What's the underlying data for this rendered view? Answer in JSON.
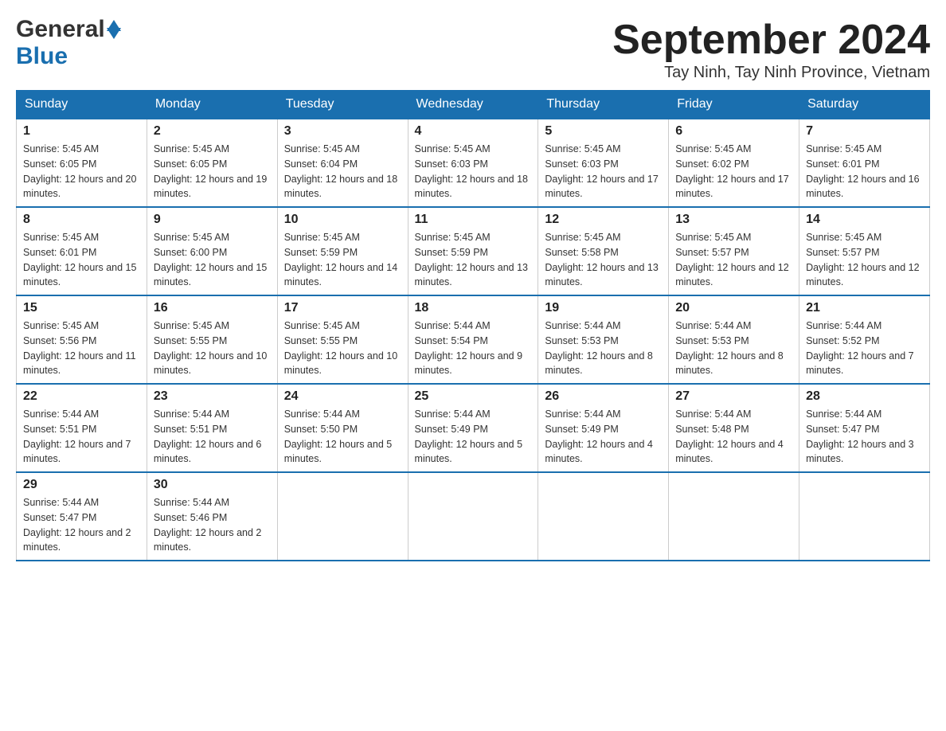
{
  "header": {
    "logo_general": "General",
    "logo_blue": "Blue",
    "month_title": "September 2024",
    "location": "Tay Ninh, Tay Ninh Province, Vietnam"
  },
  "days_of_week": [
    "Sunday",
    "Monday",
    "Tuesday",
    "Wednesday",
    "Thursday",
    "Friday",
    "Saturday"
  ],
  "weeks": [
    [
      {
        "day": "1",
        "sunrise": "Sunrise: 5:45 AM",
        "sunset": "Sunset: 6:05 PM",
        "daylight": "Daylight: 12 hours and 20 minutes."
      },
      {
        "day": "2",
        "sunrise": "Sunrise: 5:45 AM",
        "sunset": "Sunset: 6:05 PM",
        "daylight": "Daylight: 12 hours and 19 minutes."
      },
      {
        "day": "3",
        "sunrise": "Sunrise: 5:45 AM",
        "sunset": "Sunset: 6:04 PM",
        "daylight": "Daylight: 12 hours and 18 minutes."
      },
      {
        "day": "4",
        "sunrise": "Sunrise: 5:45 AM",
        "sunset": "Sunset: 6:03 PM",
        "daylight": "Daylight: 12 hours and 18 minutes."
      },
      {
        "day": "5",
        "sunrise": "Sunrise: 5:45 AM",
        "sunset": "Sunset: 6:03 PM",
        "daylight": "Daylight: 12 hours and 17 minutes."
      },
      {
        "day": "6",
        "sunrise": "Sunrise: 5:45 AM",
        "sunset": "Sunset: 6:02 PM",
        "daylight": "Daylight: 12 hours and 17 minutes."
      },
      {
        "day": "7",
        "sunrise": "Sunrise: 5:45 AM",
        "sunset": "Sunset: 6:01 PM",
        "daylight": "Daylight: 12 hours and 16 minutes."
      }
    ],
    [
      {
        "day": "8",
        "sunrise": "Sunrise: 5:45 AM",
        "sunset": "Sunset: 6:01 PM",
        "daylight": "Daylight: 12 hours and 15 minutes."
      },
      {
        "day": "9",
        "sunrise": "Sunrise: 5:45 AM",
        "sunset": "Sunset: 6:00 PM",
        "daylight": "Daylight: 12 hours and 15 minutes."
      },
      {
        "day": "10",
        "sunrise": "Sunrise: 5:45 AM",
        "sunset": "Sunset: 5:59 PM",
        "daylight": "Daylight: 12 hours and 14 minutes."
      },
      {
        "day": "11",
        "sunrise": "Sunrise: 5:45 AM",
        "sunset": "Sunset: 5:59 PM",
        "daylight": "Daylight: 12 hours and 13 minutes."
      },
      {
        "day": "12",
        "sunrise": "Sunrise: 5:45 AM",
        "sunset": "Sunset: 5:58 PM",
        "daylight": "Daylight: 12 hours and 13 minutes."
      },
      {
        "day": "13",
        "sunrise": "Sunrise: 5:45 AM",
        "sunset": "Sunset: 5:57 PM",
        "daylight": "Daylight: 12 hours and 12 minutes."
      },
      {
        "day": "14",
        "sunrise": "Sunrise: 5:45 AM",
        "sunset": "Sunset: 5:57 PM",
        "daylight": "Daylight: 12 hours and 12 minutes."
      }
    ],
    [
      {
        "day": "15",
        "sunrise": "Sunrise: 5:45 AM",
        "sunset": "Sunset: 5:56 PM",
        "daylight": "Daylight: 12 hours and 11 minutes."
      },
      {
        "day": "16",
        "sunrise": "Sunrise: 5:45 AM",
        "sunset": "Sunset: 5:55 PM",
        "daylight": "Daylight: 12 hours and 10 minutes."
      },
      {
        "day": "17",
        "sunrise": "Sunrise: 5:45 AM",
        "sunset": "Sunset: 5:55 PM",
        "daylight": "Daylight: 12 hours and 10 minutes."
      },
      {
        "day": "18",
        "sunrise": "Sunrise: 5:44 AM",
        "sunset": "Sunset: 5:54 PM",
        "daylight": "Daylight: 12 hours and 9 minutes."
      },
      {
        "day": "19",
        "sunrise": "Sunrise: 5:44 AM",
        "sunset": "Sunset: 5:53 PM",
        "daylight": "Daylight: 12 hours and 8 minutes."
      },
      {
        "day": "20",
        "sunrise": "Sunrise: 5:44 AM",
        "sunset": "Sunset: 5:53 PM",
        "daylight": "Daylight: 12 hours and 8 minutes."
      },
      {
        "day": "21",
        "sunrise": "Sunrise: 5:44 AM",
        "sunset": "Sunset: 5:52 PM",
        "daylight": "Daylight: 12 hours and 7 minutes."
      }
    ],
    [
      {
        "day": "22",
        "sunrise": "Sunrise: 5:44 AM",
        "sunset": "Sunset: 5:51 PM",
        "daylight": "Daylight: 12 hours and 7 minutes."
      },
      {
        "day": "23",
        "sunrise": "Sunrise: 5:44 AM",
        "sunset": "Sunset: 5:51 PM",
        "daylight": "Daylight: 12 hours and 6 minutes."
      },
      {
        "day": "24",
        "sunrise": "Sunrise: 5:44 AM",
        "sunset": "Sunset: 5:50 PM",
        "daylight": "Daylight: 12 hours and 5 minutes."
      },
      {
        "day": "25",
        "sunrise": "Sunrise: 5:44 AM",
        "sunset": "Sunset: 5:49 PM",
        "daylight": "Daylight: 12 hours and 5 minutes."
      },
      {
        "day": "26",
        "sunrise": "Sunrise: 5:44 AM",
        "sunset": "Sunset: 5:49 PM",
        "daylight": "Daylight: 12 hours and 4 minutes."
      },
      {
        "day": "27",
        "sunrise": "Sunrise: 5:44 AM",
        "sunset": "Sunset: 5:48 PM",
        "daylight": "Daylight: 12 hours and 4 minutes."
      },
      {
        "day": "28",
        "sunrise": "Sunrise: 5:44 AM",
        "sunset": "Sunset: 5:47 PM",
        "daylight": "Daylight: 12 hours and 3 minutes."
      }
    ],
    [
      {
        "day": "29",
        "sunrise": "Sunrise: 5:44 AM",
        "sunset": "Sunset: 5:47 PM",
        "daylight": "Daylight: 12 hours and 2 minutes."
      },
      {
        "day": "30",
        "sunrise": "Sunrise: 5:44 AM",
        "sunset": "Sunset: 5:46 PM",
        "daylight": "Daylight: 12 hours and 2 minutes."
      },
      null,
      null,
      null,
      null,
      null
    ]
  ]
}
